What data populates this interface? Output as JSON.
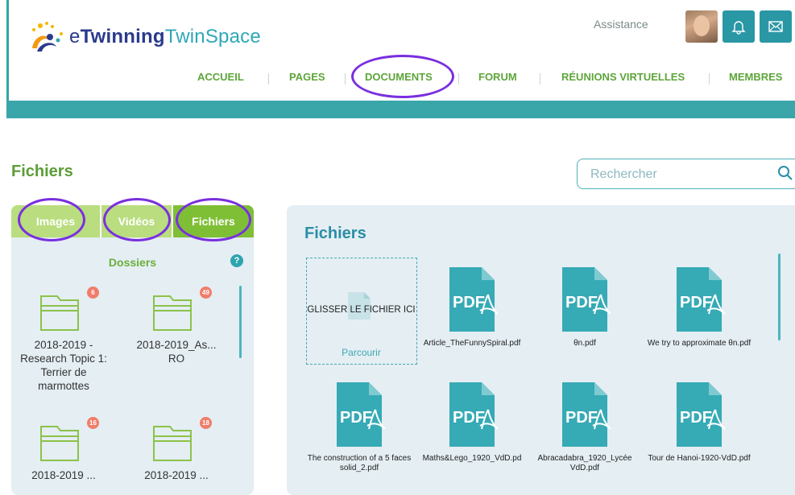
{
  "header": {
    "logo_prefix": "e",
    "logo_twinning": "Twinning",
    "logo_space": "TwinSpace",
    "assistance": "Assistance"
  },
  "nav": [
    "ACCUEIL",
    "PAGES",
    "DOCUMENTS",
    "FORUM",
    "RÉUNIONS VIRTUELLES",
    "MEMBRES"
  ],
  "page": {
    "title": "Fichiers",
    "search_placeholder": "Rechercher"
  },
  "left_panel": {
    "tabs": [
      "Images",
      "Vidéos",
      "Fichiers"
    ],
    "active_tab": "Fichiers",
    "folders_title": "Dossiers",
    "help": "?",
    "folders": [
      {
        "name": "2018-2019 - Research Topic 1: Terrier de marmottes",
        "count": "6"
      },
      {
        "name": "2018-2019_As... RO",
        "count": "49"
      },
      {
        "name": "2018-2019 ...",
        "count": "16"
      },
      {
        "name": "2018-2019 ...",
        "count": "18"
      }
    ]
  },
  "right_panel": {
    "title": "Fichiers",
    "dropzone_text": "GLISSER LE FICHIER ICI",
    "browse": "Parcourir",
    "files": [
      {
        "name": "Article_TheFunnySpiral.pdf",
        "icon": "pdf-icon",
        "badge": "PDF"
      },
      {
        "name": "θn.pdf",
        "icon": "pdf-icon",
        "badge": "PDF"
      },
      {
        "name": "We try to approximate θn.pdf",
        "icon": "pdf-icon",
        "badge": "PDF"
      },
      {
        "name": "The construction of a 5 faces solid_2.pdf",
        "icon": "pdf-icon",
        "badge": "PDF"
      },
      {
        "name": "Maths&Lego_1920_VdD.pd",
        "icon": "pdf-icon",
        "badge": "PDF"
      },
      {
        "name": "Abracadabra_1920_Lycée VdD.pdf",
        "icon": "pdf-icon",
        "badge": "PDF"
      },
      {
        "name": "Tour de Hanoi-1920-VdD.pdf",
        "icon": "pdf-icon",
        "badge": "PDF"
      }
    ]
  },
  "colors": {
    "accent_green": "#5da53a",
    "teal": "#2fa7a7",
    "annotation_ring": "#7a2fe0",
    "badge": "#f07d6a"
  }
}
